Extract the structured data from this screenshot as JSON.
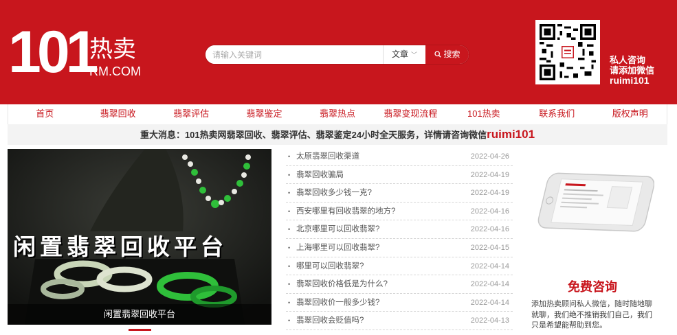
{
  "logo": {
    "number": "101",
    "chinese": "热卖",
    "domain": "RM.COM"
  },
  "search": {
    "placeholder": "请输入关键词",
    "category": "文章",
    "button": "搜索"
  },
  "wechat": {
    "line1": "私人咨询",
    "line2": "请添加微信",
    "id": "ruimi101"
  },
  "nav": [
    "首页",
    "翡翠回收",
    "翡翠评估",
    "翡翠鉴定",
    "翡翠热点",
    "翡翠变现流程",
    "101热卖",
    "联系我们",
    "版权声明"
  ],
  "notice": {
    "text": "重大消息：101热卖网翡翠回收、翡翠评估、翡翠鉴定24小时全天服务，详情请咨询微信",
    "wechat_id": "ruimi101"
  },
  "banner": {
    "overlay_text": "闲置翡翠回收平台",
    "caption": "闲置翡翠回收平台"
  },
  "news": [
    {
      "title": "太原翡翠回收渠道",
      "date": "2022-04-26"
    },
    {
      "title": "翡翠回收骗局",
      "date": "2022-04-19"
    },
    {
      "title": "翡翠回收多少钱一克?",
      "date": "2022-04-19"
    },
    {
      "title": "西安哪里有回收翡翠的地方?",
      "date": "2022-04-16"
    },
    {
      "title": "北京哪里可以回收翡翠?",
      "date": "2022-04-16"
    },
    {
      "title": "上海哪里可以回收翡翠?",
      "date": "2022-04-15"
    },
    {
      "title": "哪里可以回收翡翠?",
      "date": "2022-04-14"
    },
    {
      "title": "翡翠回收价格低是为什么?",
      "date": "2022-04-14"
    },
    {
      "title": "翡翠回收价一般多少钱?",
      "date": "2022-04-14"
    },
    {
      "title": "翡翠回收会贬值吗?",
      "date": "2022-04-13"
    }
  ],
  "consult": {
    "title": "免费咨询",
    "description": "添加热卖顾问私人微信，随时随地聊就聊，我们绝不推销我们自己，我们只是希望能帮助到您。"
  },
  "colors": {
    "brand_red": "#c8161d",
    "jade_green": "#2fbf3a"
  }
}
